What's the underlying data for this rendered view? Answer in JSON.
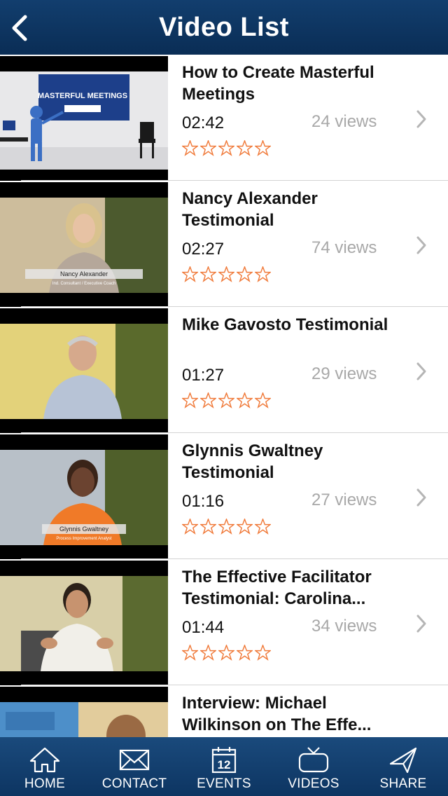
{
  "header": {
    "title": "Video List"
  },
  "videos": [
    {
      "title": "How to Create Masterful Meetings",
      "duration": "02:42",
      "views": "24 views",
      "rating": 0,
      "thumb_text": "MASTERFUL MEETINGS",
      "thumb_caption": "",
      "thumb_sub": ""
    },
    {
      "title": "Nancy Alexander Testimonial",
      "duration": "02:27",
      "views": "74 views",
      "rating": 0,
      "thumb_caption": "Nancy Alexander",
      "thumb_sub": "Ind. Consultant / Executive Coach"
    },
    {
      "title": "Mike Gavosto Testimonial",
      "duration": "01:27",
      "views": "29 views",
      "rating": 0,
      "thumb_caption": "",
      "thumb_sub": ""
    },
    {
      "title": "Glynnis Gwaltney Testimonial",
      "duration": "01:16",
      "views": "27 views",
      "rating": 0,
      "thumb_caption": "Glynnis Gwaltney",
      "thumb_sub": "Process Improvement Analyst"
    },
    {
      "title": "The Effective Facilitator Testimonial: Carolina...",
      "duration": "01:44",
      "views": "34 views",
      "rating": 0,
      "thumb_caption": "",
      "thumb_sub": ""
    },
    {
      "title": "Interview: Michael Wilkinson on The Effe...",
      "duration": "",
      "views": "",
      "rating": 0,
      "thumb_caption": "",
      "thumb_sub": ""
    }
  ],
  "tabs": [
    {
      "label": "HOME",
      "icon": "home-icon"
    },
    {
      "label": "CONTACT",
      "icon": "envelope-icon"
    },
    {
      "label": "EVENTS",
      "icon": "calendar-icon",
      "calendar_day": "12"
    },
    {
      "label": "VIDEOS",
      "icon": "tv-icon"
    },
    {
      "label": "SHARE",
      "icon": "share-arrow-icon"
    }
  ],
  "colors": {
    "navbar": "#0d3562",
    "star_outline": "#f07a3a",
    "views_text": "#a8a8a8"
  }
}
